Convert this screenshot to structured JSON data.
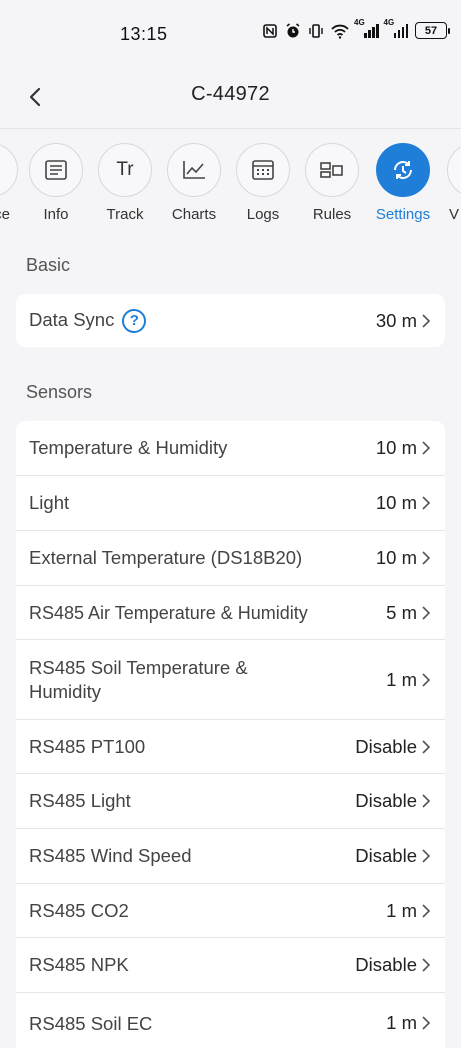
{
  "status_bar": {
    "time": "13:15",
    "network_1": "4G",
    "network_2": "4G",
    "battery": "57"
  },
  "header": {
    "title": "C-44972"
  },
  "tabs": [
    {
      "label": "ce",
      "icon": "partial-icon"
    },
    {
      "label": "Info",
      "icon": "document-icon"
    },
    {
      "label": "Track",
      "icon": "track-icon",
      "glyph": "Tr"
    },
    {
      "label": "Charts",
      "icon": "line-chart-icon"
    },
    {
      "label": "Logs",
      "icon": "calendar-icon"
    },
    {
      "label": "Rules",
      "icon": "rules-icon"
    },
    {
      "label": "Settings",
      "icon": "settings-sync-icon",
      "active": true
    },
    {
      "label": "V",
      "icon": "partial-icon"
    }
  ],
  "basic": {
    "section_title": "Basic",
    "data_sync": {
      "label": "Data Sync",
      "value": "30 m",
      "help": "?"
    }
  },
  "sensors": {
    "section_title": "Sensors",
    "items": [
      {
        "label": "Temperature & Humidity",
        "value": "10 m"
      },
      {
        "label": "Light",
        "value": "10 m"
      },
      {
        "label": "External Temperature (DS18B20)",
        "value": "10 m"
      },
      {
        "label": "RS485 Air Temperature & Humidity",
        "value": "5 m"
      },
      {
        "label": "RS485 Soil Temperature & Humidity",
        "value": "1 m"
      },
      {
        "label": "RS485 PT100",
        "value": "Disable"
      },
      {
        "label": "RS485 Light",
        "value": "Disable"
      },
      {
        "label": "RS485 Wind Speed",
        "value": "Disable"
      },
      {
        "label": "RS485 CO2",
        "value": "1 m"
      },
      {
        "label": "RS485 NPK",
        "value": "Disable"
      },
      {
        "label": "RS485 Soil EC",
        "value": "1 m"
      }
    ]
  },
  "colors": {
    "accent": "#1e7ed8",
    "background": "#f5f5f7",
    "card": "#ffffff"
  }
}
